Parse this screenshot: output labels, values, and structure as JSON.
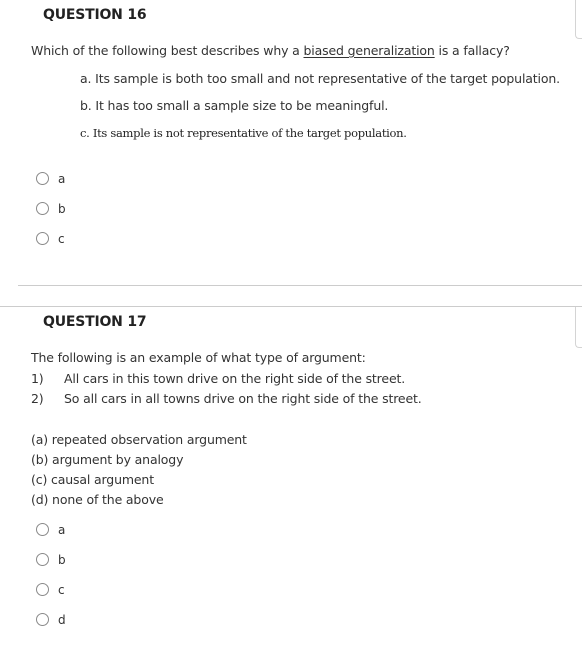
{
  "questions": [
    {
      "title": "QUESTION 16",
      "prompt_before": "Which of the following best describes why a ",
      "prompt_term": "biased generalization",
      "prompt_after": " is a fallacy?",
      "statements": [
        "a. Its sample is both too small and not representative of the target population.",
        "b. It has too small a sample size to be meaningful.",
        "c. Its sample is not representative of the target population."
      ],
      "options": [
        {
          "label": "a",
          "selected": false
        },
        {
          "label": "b",
          "selected": false
        },
        {
          "label": "c",
          "selected": false
        }
      ]
    },
    {
      "title": "QUESTION 17",
      "prompt": "The following is an example of what type of argument:",
      "premises": [
        {
          "num": "1)",
          "text": "All cars in this town drive on the right side of the street."
        },
        {
          "num": "2)",
          "text": "So all cars in all towns drive on the right side of the street."
        }
      ],
      "choices": [
        "(a) repeated observation argument",
        "(b) argument by analogy",
        "(c) causal argument",
        "(d) none of the above"
      ],
      "options": [
        {
          "label": "a",
          "selected": false
        },
        {
          "label": "b",
          "selected": false
        },
        {
          "label": "c",
          "selected": false
        },
        {
          "label": "d",
          "selected": false
        }
      ]
    }
  ]
}
